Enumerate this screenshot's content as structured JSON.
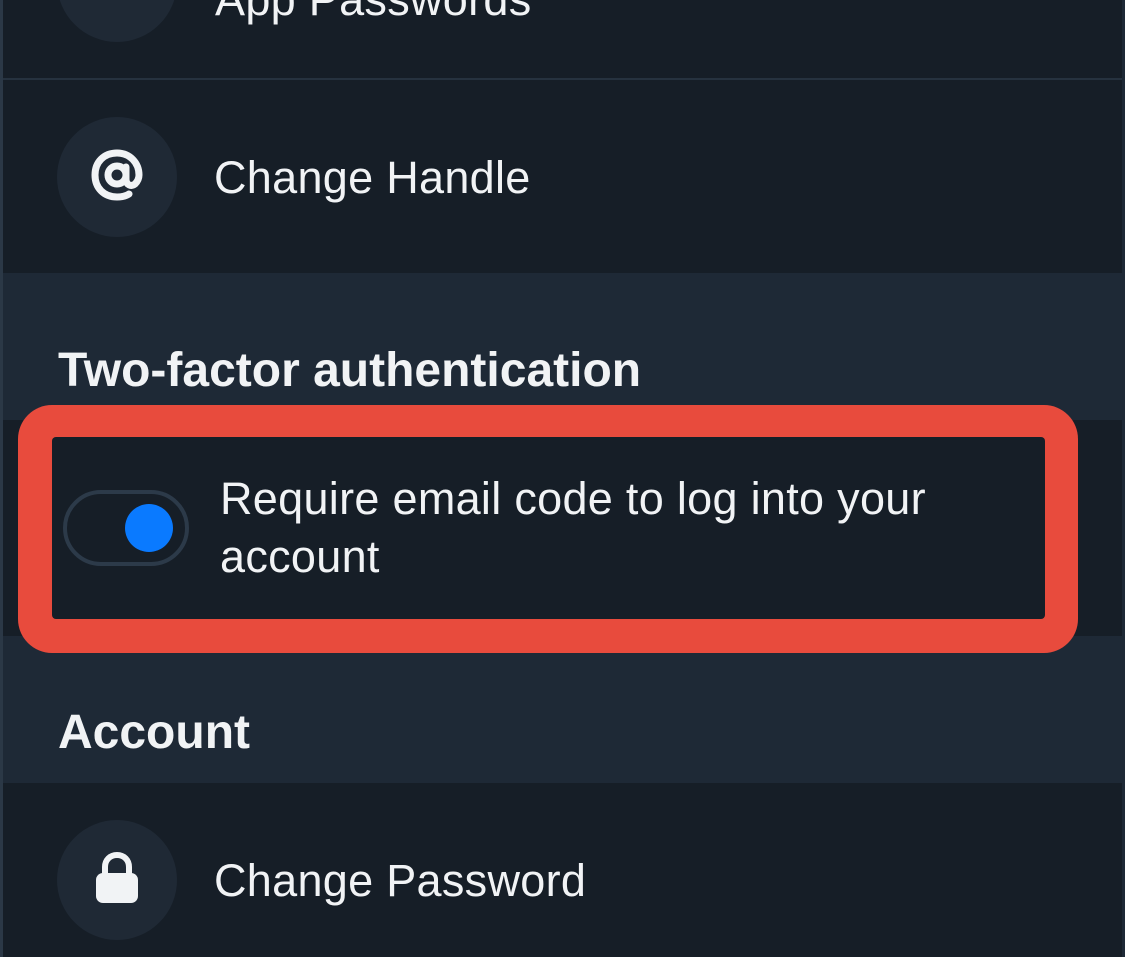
{
  "rows": {
    "top_partial": {
      "label": "App Passwords",
      "icon": "key-icon"
    },
    "change_handle": {
      "label": "Change Handle",
      "icon": "at-sign-icon"
    },
    "change_password": {
      "label": "Change Password",
      "icon": "lock-icon"
    }
  },
  "sections": {
    "two_factor": {
      "title": "Two-factor authentication",
      "toggle": {
        "label": "Require email code to log into your account",
        "enabled": true
      }
    },
    "account": {
      "title": "Account"
    }
  },
  "colors": {
    "background": "#1e2936",
    "row_background": "#161e27",
    "icon_circle": "#1f2935",
    "highlight": "#e84b3d",
    "toggle_on": "#0a7aff",
    "text": "#f1f3f5"
  }
}
